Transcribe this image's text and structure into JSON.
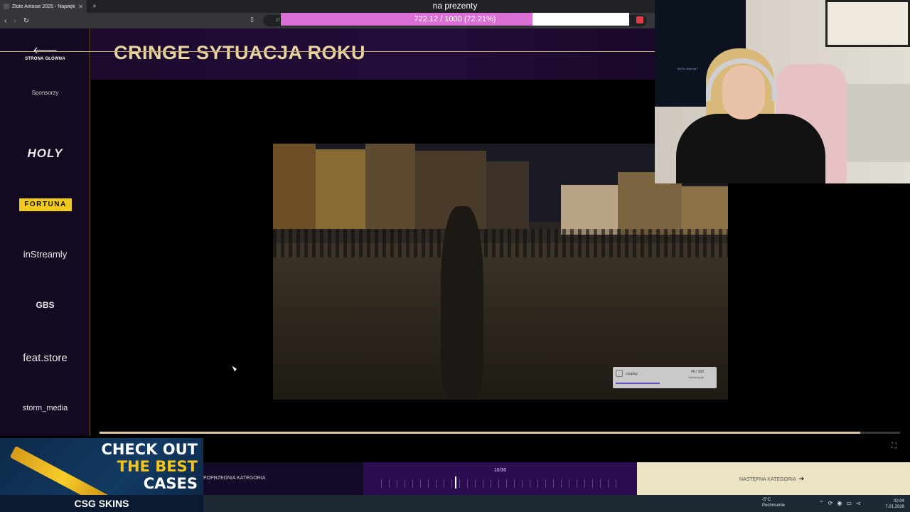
{
  "browser": {
    "tab_title": "Złote Antosie 2025 - Najwięk",
    "address_partial": "zl"
  },
  "overlay": {
    "title": "na prezenty",
    "progress_text": "722.12 / 1000 (72.21%)",
    "progress_fraction": 0.7221,
    "fill_color": "#db6fd6"
  },
  "sidebar": {
    "back_label": "STRONA GŁÓWNA",
    "sponsors_heading": "Sponsorzy",
    "sponsors": [
      "HOLY",
      "FORTUNA",
      "inStreamly",
      "GBS",
      "feat.store",
      "storm_media"
    ]
  },
  "page": {
    "title": "CRINGE SYTUACJA ROKU",
    "accent_color": "#e8d3a1"
  },
  "video": {
    "widget_name": "cosplay",
    "widget_count": "46 / 150",
    "widget_sub": "Subskrypcje"
  },
  "playback": {
    "progress_fraction": 0.95
  },
  "category_nav": {
    "prev_label": "POPRZEDNIA KATEGORIA",
    "counter": "10/30",
    "next_label": "NASTĘPNA KATEGORIA"
  },
  "ad": {
    "line1": "CHECK OUT",
    "line2": "THE BEST",
    "line3": "CASES",
    "brand": "CSG SKINS"
  },
  "taskbar": {
    "weather_temp": "-5°C",
    "weather_desc": "Pochmurnie",
    "time": "02:04",
    "date": "7.01.2026"
  },
  "webcam": {
    "monitor_text": "MUSL stéyrsyt ?"
  }
}
